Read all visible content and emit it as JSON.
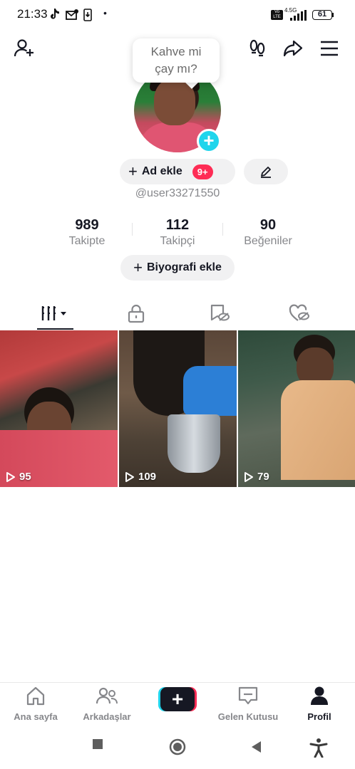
{
  "status_bar": {
    "time": "21:33",
    "dot": "•",
    "network": "4.5G",
    "volte": "Vo LTE",
    "battery": "61"
  },
  "profile": {
    "bubble_text_line1": "Kahve mi",
    "bubble_text_line2": "çay mı?",
    "add_name_label": "Ad ekle",
    "badge": "9+",
    "username": "@user33271550",
    "bio_button_label": "Biyografi ekle"
  },
  "stats": [
    {
      "value": "989",
      "label": "Takipte"
    },
    {
      "value": "112",
      "label": "Takipçi"
    },
    {
      "value": "90",
      "label": "Beğeniler"
    }
  ],
  "tabs": [
    {
      "icon": "videos-grid-icon"
    },
    {
      "icon": "lock-icon"
    },
    {
      "icon": "bookmark-hidden-icon"
    },
    {
      "icon": "liked-hidden-icon"
    }
  ],
  "videos": [
    {
      "views": "95"
    },
    {
      "views": "109"
    },
    {
      "views": "79"
    }
  ],
  "bottom_nav": [
    {
      "label": "Ana sayfa",
      "icon": "home-icon"
    },
    {
      "label": "Arkadaşlar",
      "icon": "friends-icon"
    },
    {
      "label": "",
      "icon": "create-icon"
    },
    {
      "label": "Gelen Kutusu",
      "icon": "inbox-icon"
    },
    {
      "label": "Profil",
      "icon": "profile-icon"
    }
  ],
  "colors": {
    "accent_red": "#fe2c55",
    "accent_cyan": "#20d5ec",
    "text_primary": "#161823",
    "text_secondary": "#86878b"
  }
}
